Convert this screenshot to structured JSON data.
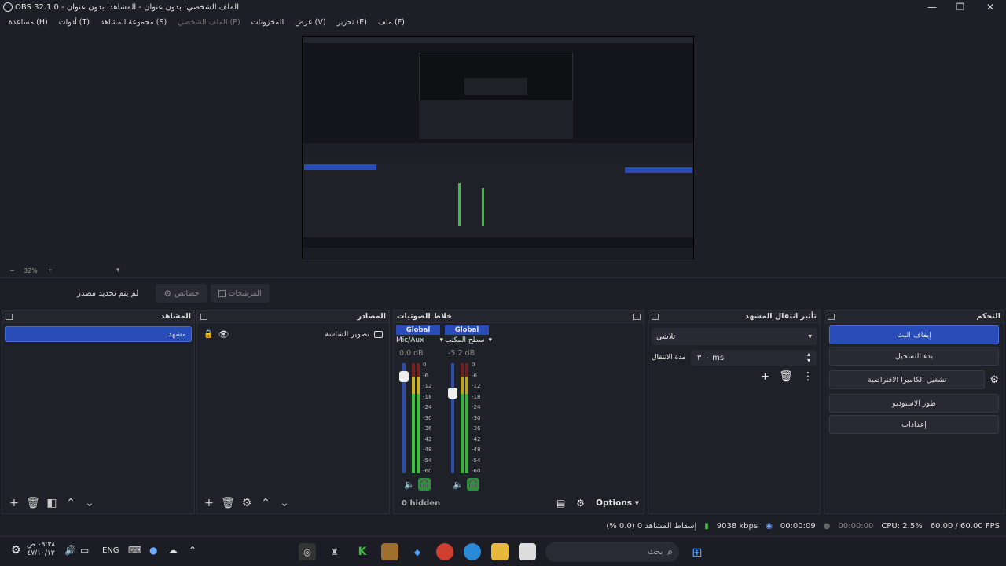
{
  "window": {
    "title": "OBS 32.1.0 - الملف الشخصي: بدون عنوان - المشاهد: بدون عنوان"
  },
  "menu": [
    {
      "label": "ملف (F)"
    },
    {
      "label": "تحرير (E)"
    },
    {
      "label": "عرض (V)"
    },
    {
      "label": "المخزونات"
    },
    {
      "label": "الملف الشخصي (P)",
      "dim": true
    },
    {
      "label": "مجموعة المشاهد (S)"
    },
    {
      "label": "أدوات (T)"
    },
    {
      "label": "مساعدة (H)"
    }
  ],
  "preview": {
    "zoom": "32%"
  },
  "context": {
    "no_source": "لم يتم تحديد مصدر",
    "properties": "خصائص",
    "filters": "المرشحات"
  },
  "scenes": {
    "title": "المشاهد",
    "items": [
      "مشهد"
    ]
  },
  "sources": {
    "title": "المصادر",
    "items": [
      {
        "name": "تصوير الشاشة"
      }
    ]
  },
  "mixer": {
    "title": "خلاط الصوتيات",
    "channels": [
      {
        "badge": "Global",
        "name": "Mic/Aux",
        "db": "0.0 dB",
        "level": 0.93
      },
      {
        "badge": "Global",
        "name": "صوت سطح المكتب",
        "db": "-5.2 dB",
        "level": 0.78
      }
    ],
    "ticks": [
      "0",
      "-6",
      "-12",
      "-18",
      "-24",
      "-30",
      "-36",
      "-42",
      "-48",
      "-54",
      "-60"
    ],
    "hidden": "0 hidden",
    "options": "Options"
  },
  "transitions": {
    "title": "تأثير انتقال المشهد",
    "type": "تلاشي",
    "duration_label": "مدة الانتقال",
    "duration": "٣٠٠ ms"
  },
  "controls": {
    "title": "التحكم",
    "buttons": [
      "إيقاف البث",
      "بدء التسجيل",
      "تشغيل الكاميرا الافتراضية",
      "طور الاستوديو",
      "إعدادات"
    ]
  },
  "status": {
    "dropped": "إسقاط المشاهد 0 (0.0 %)",
    "bitrate": "9038 kbps",
    "stream_time": "00:00:09",
    "rec_time": "00:00:00",
    "cpu": "CPU: 2.5%",
    "fps": "60.00 / 60.00 FPS"
  },
  "taskbar": {
    "lang": "ENG",
    "time": "٠٩:٣٨ ص",
    "date": "٤٧/١٠/١٣",
    "search": "بحث"
  },
  "colors": {
    "accent": "#284cb8",
    "meter_green": "#3fbf3f",
    "meter_yellow": "#c8b22a",
    "meter_red": "#c03030"
  }
}
